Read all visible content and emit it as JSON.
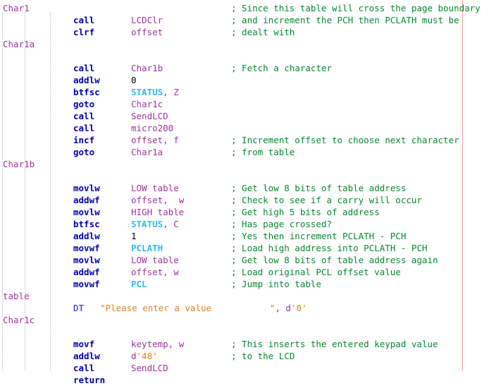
{
  "editor": {
    "title": "Assembly Source Listing",
    "colors": {
      "background": "#ffffff",
      "label": "#a0329b",
      "instruction": "#0000b0",
      "directive": "#2020c0",
      "symbol": "#a0329b",
      "register": "#33bbee",
      "string": "#e08214",
      "comment": "#008a2e",
      "indent_guide": "#bdbdbd",
      "margin_line": "#f0a0a8"
    },
    "indent_guides": [
      3,
      35,
      71
    ],
    "margin_line_x": 656
  },
  "lines": [
    {
      "label": "Char1",
      "op": "",
      "arg": "",
      "comment": "; Since this table will cross the page boundary"
    },
    {
      "label": "",
      "op": "call",
      "arg": "LCDClr",
      "comment": "; and increment the PCH then PCLATH must be",
      "arg_kind": "sym"
    },
    {
      "label": "",
      "op": "clrf",
      "arg": "offset",
      "comment": "; dealt with",
      "arg_kind": "sym"
    },
    {
      "label": "Char1a",
      "op": "",
      "arg": "",
      "comment": ""
    },
    {
      "label": "",
      "op": "",
      "arg": "",
      "comment": ""
    },
    {
      "label": "",
      "op": "call",
      "arg": "Char1b",
      "comment": "; Fetch a character",
      "arg_kind": "sym"
    },
    {
      "label": "",
      "op": "addlw",
      "arg": "0",
      "comment": "",
      "arg_kind": "num"
    },
    {
      "label": "",
      "op": "btfsc",
      "arg": "STATUS, Z",
      "comment": "",
      "arg_kind": "reg",
      "reg": "STATUS",
      "reg_rest": ", Z"
    },
    {
      "label": "",
      "op": "goto",
      "arg": "Char1c",
      "comment": "",
      "arg_kind": "sym"
    },
    {
      "label": "",
      "op": "call",
      "arg": "SendLCD",
      "comment": "",
      "arg_kind": "sym"
    },
    {
      "label": "",
      "op": "call",
      "arg": "micro200",
      "comment": "",
      "arg_kind": "sym"
    },
    {
      "label": "",
      "op": "incf",
      "arg": "offset, f",
      "comment": "; Increment offset to choose next character",
      "arg_kind": "sym"
    },
    {
      "label": "",
      "op": "goto",
      "arg": "Char1a",
      "comment": "; from table",
      "arg_kind": "sym"
    },
    {
      "label": "Char1b",
      "op": "",
      "arg": "",
      "comment": ""
    },
    {
      "label": "",
      "op": "",
      "arg": "",
      "comment": ""
    },
    {
      "label": "",
      "op": "movlw",
      "arg": "LOW table",
      "comment": "; Get low 8 bits of table address",
      "arg_kind": "sym"
    },
    {
      "label": "",
      "op": "addwf",
      "arg": "offset,  w",
      "comment": "; Check to see if a carry will occur",
      "arg_kind": "sym"
    },
    {
      "label": "",
      "op": "movlw",
      "arg": "HIGH table",
      "comment": "; Get high 5 bits of address",
      "arg_kind": "sym"
    },
    {
      "label": "",
      "op": "btfsc",
      "arg": "STATUS, C",
      "comment": "; Has page crossed?",
      "arg_kind": "reg",
      "reg": "STATUS",
      "reg_rest": ", C"
    },
    {
      "label": "",
      "op": "addlw",
      "arg": "1",
      "comment": "; Yes then increment PCLATH - PCH",
      "arg_kind": "num"
    },
    {
      "label": "",
      "op": "movwf",
      "arg": "PCLATH",
      "comment": "; Load high address into PCLATH - PCH",
      "arg_kind": "reg",
      "reg": "PCLATH",
      "reg_rest": ""
    },
    {
      "label": "",
      "op": "movlw",
      "arg": "LOW table",
      "comment": "; Get low 8 bits of table address again",
      "arg_kind": "sym"
    },
    {
      "label": "",
      "op": "addwf",
      "arg": "offset, w",
      "comment": "; Load original PCL offset value",
      "arg_kind": "sym"
    },
    {
      "label": "",
      "op": "movwf",
      "arg": "PCL",
      "comment": "; Jump into table",
      "arg_kind": "reg",
      "reg": "PCL",
      "reg_rest": ""
    },
    {
      "label": "table",
      "op": "",
      "arg": "",
      "comment": ""
    },
    {
      "label": "",
      "op": "DT",
      "arg": "",
      "comment": "",
      "op_kind": "dir",
      "special": "dt",
      "dt_string": "\"Please enter a value           \"",
      "dt_sep": ", ",
      "dt_radix": "d",
      "dt_value": "'0'"
    },
    {
      "label": "Char1c",
      "op": "",
      "arg": "",
      "comment": ""
    },
    {
      "label": "",
      "op": "",
      "arg": "",
      "comment": ""
    },
    {
      "label": "",
      "op": "movf",
      "arg": "keytemp, w",
      "comment": "; This inserts the entered keypad value",
      "arg_kind": "sym"
    },
    {
      "label": "",
      "op": "addlw",
      "arg": "",
      "comment": "; to the LCD",
      "special": "radix",
      "radix": "d",
      "radix_value": "'48'"
    },
    {
      "label": "",
      "op": "call",
      "arg": "SendLCD",
      "comment": "",
      "arg_kind": "sym"
    },
    {
      "label": "",
      "op": "return",
      "arg": "",
      "comment": ""
    }
  ]
}
